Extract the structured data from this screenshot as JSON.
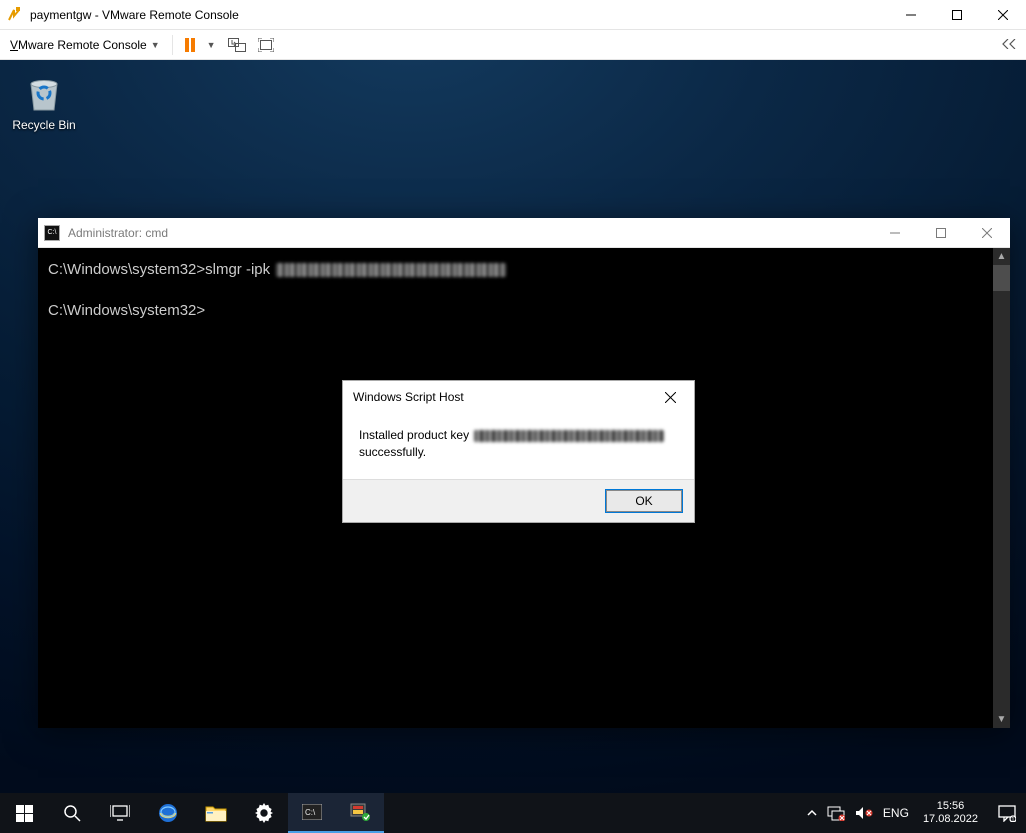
{
  "vmrc": {
    "title": "paymentgw - VMware Remote Console",
    "menu_label_pre": "V",
    "menu_label_rest": "Mware Remote Console"
  },
  "winbtns": {
    "min": "—",
    "max": "",
    "close": ""
  },
  "desktop": {
    "recycle_bin_label": "Recycle Bin"
  },
  "cmd": {
    "title": "Administrator: cmd",
    "line1_prefix": "C:\\Windows\\system32>slmgr -ipk ",
    "line2": "C:\\Windows\\system32>"
  },
  "dialog": {
    "title": "Windows Script Host",
    "msg_prefix": "Installed product key",
    "msg_suffix": "successfully.",
    "ok": "OK"
  },
  "taskbar": {
    "lang": "ENG",
    "time": "15:56",
    "date": "17.08.2022"
  },
  "tray_icons": {
    "chevron": "⌃"
  }
}
